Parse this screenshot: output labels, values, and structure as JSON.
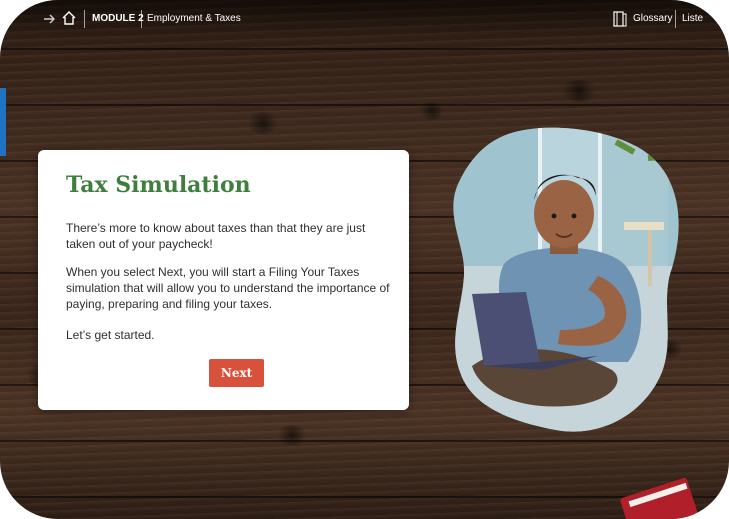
{
  "header": {
    "module_label": "MODULE 2",
    "module_title": "Employment & Taxes",
    "glossary_label": "Glossary",
    "listen_label": "Liste"
  },
  "card": {
    "title": "Tax Simulation",
    "paragraphs": [
      "There’s more to know about taxes than that they are just taken out of your paycheck!",
      "When you select Next, you will start a Filing Your Taxes simulation that will allow you to understand the importance of paying, preparing and filing your taxes.",
      "Let’s get started."
    ],
    "next_label": "Next"
  },
  "colors": {
    "title_green": "#3f7f3e",
    "button_red": "#d8513a",
    "accent_blue": "#1f73c0"
  },
  "icons": {
    "back": "arrow-icon",
    "home": "home-icon",
    "glossary": "book-icon"
  }
}
